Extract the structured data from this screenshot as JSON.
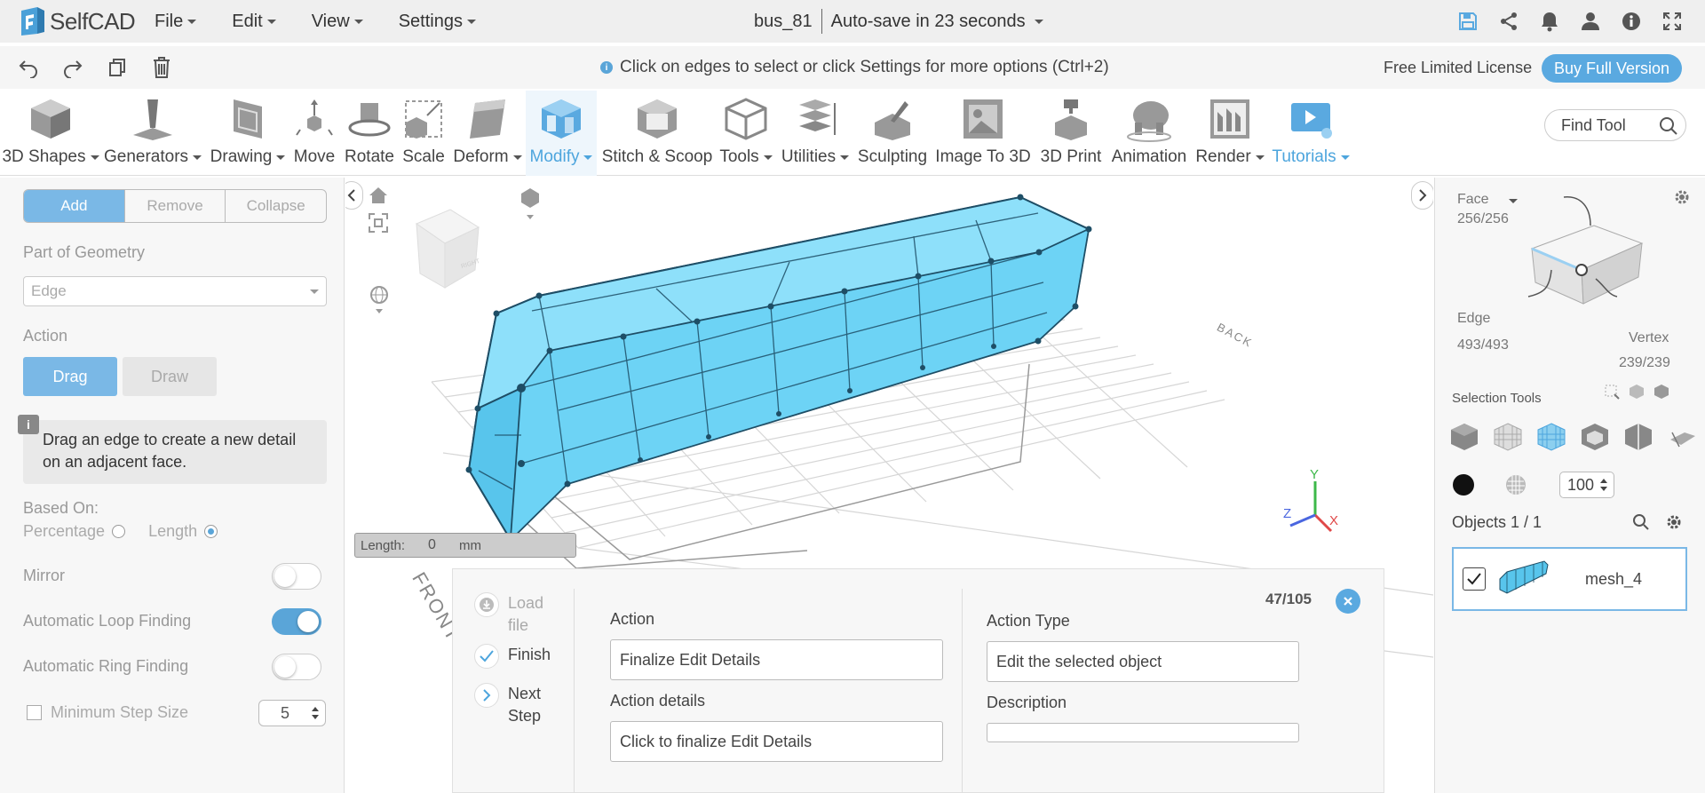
{
  "app": {
    "name": "SelfCAD"
  },
  "menu": [
    {
      "label": "File"
    },
    {
      "label": "Edit"
    },
    {
      "label": "View"
    },
    {
      "label": "Settings"
    }
  ],
  "document": {
    "name": "bus_81",
    "autosave": "Auto-save in 23 seconds"
  },
  "header_icons": [
    "save-icon",
    "share-icon",
    "bell-icon",
    "user-icon",
    "info-icon",
    "fullscreen-icon"
  ],
  "secondary": {
    "hint": "Click on edges to select or click Settings for more options (Ctrl+2)",
    "license": "Free Limited License",
    "buy": "Buy Full Version"
  },
  "toolbar": {
    "tools": [
      {
        "label": "3D Shapes",
        "dropdown": true
      },
      {
        "label": "Generators",
        "dropdown": true
      },
      {
        "label": "Drawing",
        "dropdown": true
      },
      {
        "label": "Move"
      },
      {
        "label": "Rotate"
      },
      {
        "label": "Scale"
      },
      {
        "label": "Deform",
        "dropdown": true
      },
      {
        "label": "Modify",
        "dropdown": true
      },
      {
        "label": "Stitch & Scoop"
      },
      {
        "label": "Tools",
        "dropdown": true
      },
      {
        "label": "Utilities",
        "dropdown": true
      },
      {
        "label": "Sculpting"
      },
      {
        "label": "Image To 3D"
      },
      {
        "label": "3D Print"
      },
      {
        "label": "Animation"
      },
      {
        "label": "Render",
        "dropdown": true
      },
      {
        "label": "Tutorials",
        "dropdown": true
      }
    ],
    "find_placeholder": "Find Tool"
  },
  "left_panel": {
    "segments": [
      "Add",
      "Remove",
      "Collapse"
    ],
    "part_of_geometry_label": "Part of Geometry",
    "part_of_geometry_value": "Edge",
    "action_label": "Action",
    "drag": "Drag",
    "draw": "Draw",
    "info": "Drag an edge to create a new detail on an adjacent face.",
    "based_on_label": "Based On:",
    "percentage": "Percentage",
    "length": "Length",
    "mirror": "Mirror",
    "auto_loop": "Automatic Loop Finding",
    "auto_ring": "Automatic Ring Finding",
    "min_step": "Minimum Step Size",
    "min_step_value": "5"
  },
  "viewport": {
    "length_label": "Length:",
    "length_value": "0",
    "length_unit": "mm",
    "labels": {
      "front": "FRONT",
      "back": "BACK",
      "right": "RIGHT"
    },
    "axes": {
      "x": "X",
      "y": "Y",
      "z": "Z"
    }
  },
  "tutorial": {
    "steps": [
      {
        "label": "Load file"
      },
      {
        "label": "Finish"
      },
      {
        "label": "Next Step"
      }
    ],
    "counter": "47/105",
    "action_label": "Action",
    "action_value": "Finalize Edit Details",
    "action_details_label": "Action details",
    "action_details_value": "Click to finalize Edit Details",
    "action_type_label": "Action Type",
    "action_type_value": "Edit the selected object",
    "description_label": "Description",
    "description_value": ""
  },
  "right_panel": {
    "face_label": "Face",
    "face_count": "256/256",
    "edge_label": "Edge",
    "edge_count": "493/493",
    "vertex_label": "Vertex",
    "vertex_count": "239/239",
    "selection_tools": "Selection Tools",
    "brush_size": "100",
    "objects_label": "Objects 1 / 1",
    "object_name": "mesh_4"
  },
  "colors": {
    "accent": "#5aa9e0",
    "mesh": "#6dd3f5",
    "mesh_edge": "#1e4e66"
  }
}
